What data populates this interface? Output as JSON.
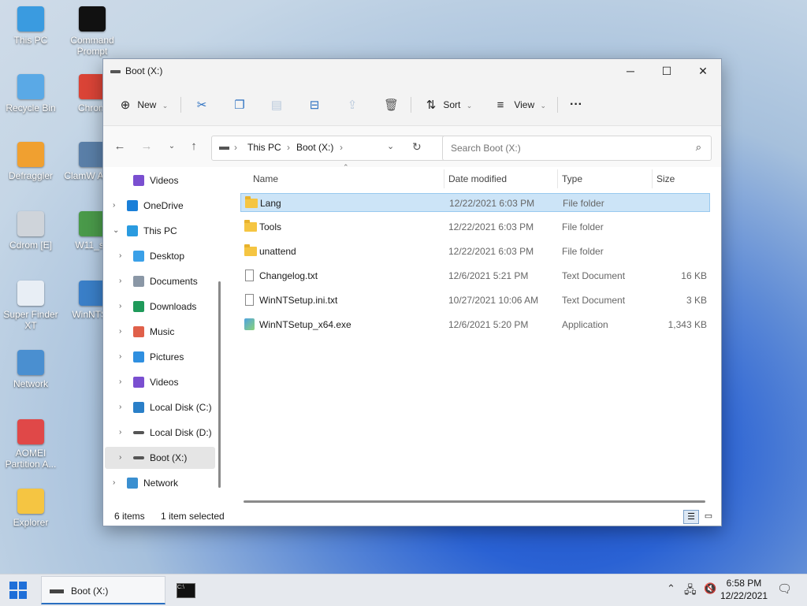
{
  "desktop_icons": [
    {
      "label": "This PC",
      "icon": "monitor-icon",
      "color": "#3a9be0"
    },
    {
      "label": "Command Prompt",
      "icon": "terminal-icon",
      "color": "#111111"
    },
    {
      "label": "Recycle Bin",
      "icon": "recycle-bin-icon",
      "color": "#5aa9e6"
    },
    {
      "label": "Chrom",
      "icon": "chrome-icon",
      "color": "#db4437"
    },
    {
      "label": "Defraggler",
      "icon": "defraggler-icon",
      "color": "#f0a030"
    },
    {
      "label": "ClamW Antivi",
      "icon": "clamwin-icon",
      "color": "#5a7fa8"
    },
    {
      "label": "Cdrom [E]",
      "icon": "cdrom-icon",
      "color": "#cfd4da"
    },
    {
      "label": "W11_se",
      "icon": "setup-icon",
      "color": "#4a9a4a"
    },
    {
      "label": "Super Finder XT",
      "icon": "magnifier-doc-icon",
      "color": "#e8eef5"
    },
    {
      "label": "WinNTSe",
      "icon": "winntsetup-icon",
      "color": "#3a7fc8"
    },
    {
      "label": "Network",
      "icon": "network-icon",
      "color": "#4a8fd0"
    },
    {
      "label": "AOMEI Partition A...",
      "icon": "aomei-icon",
      "color": "#e04848"
    },
    {
      "label": "Explorer",
      "icon": "folder-icon",
      "color": "#f5c542"
    }
  ],
  "window": {
    "title": "Boot (X:)",
    "minimize": "─",
    "maximize": "☐",
    "close": "✕"
  },
  "command_bar": {
    "new_label": "New",
    "sort_label": "Sort",
    "view_label": "View",
    "more": "···"
  },
  "address": {
    "crumbs": [
      "This PC",
      "Boot (X:)"
    ],
    "search_placeholder": "Search Boot (X:)"
  },
  "nav_pane": [
    {
      "label": "Videos",
      "icon": "videos-icon",
      "color": "#7a4fd0",
      "level": 1,
      "chevron": ""
    },
    {
      "label": "OneDrive",
      "icon": "onedrive-icon",
      "color": "#1a7fd8",
      "level": 0,
      "chevron": "›"
    },
    {
      "label": "This PC",
      "icon": "this-pc-icon",
      "color": "#2a9be0",
      "level": 0,
      "chevron": "⌄"
    },
    {
      "label": "Desktop",
      "icon": "desktop-icon",
      "color": "#3aa0e8",
      "level": 1,
      "chevron": "›"
    },
    {
      "label": "Documents",
      "icon": "documents-icon",
      "color": "#8a97a6",
      "level": 1,
      "chevron": "›"
    },
    {
      "label": "Downloads",
      "icon": "downloads-icon",
      "color": "#1f9a5a",
      "level": 1,
      "chevron": "›"
    },
    {
      "label": "Music",
      "icon": "music-icon",
      "color": "#e0604a",
      "level": 1,
      "chevron": "›"
    },
    {
      "label": "Pictures",
      "icon": "pictures-icon",
      "color": "#2f8fe0",
      "level": 1,
      "chevron": "›"
    },
    {
      "label": "Videos",
      "icon": "videos-icon",
      "color": "#7a4fd0",
      "level": 1,
      "chevron": "›"
    },
    {
      "label": "Local Disk (C:)",
      "icon": "windows-drive-icon",
      "color": "#2a7fc8",
      "level": 1,
      "chevron": "›"
    },
    {
      "label": "Local Disk (D:)",
      "icon": "drive-icon",
      "color": "#555555",
      "level": 1,
      "chevron": "›"
    },
    {
      "label": "Boot (X:)",
      "icon": "drive-icon",
      "color": "#555555",
      "level": 1,
      "chevron": "›",
      "selected": true
    },
    {
      "label": "Network",
      "icon": "network-icon",
      "color": "#3a8fd0",
      "level": 0,
      "chevron": "›"
    }
  ],
  "columns": {
    "name": "Name",
    "date": "Date modified",
    "type": "Type",
    "size": "Size"
  },
  "files": [
    {
      "name": "Lang",
      "date": "12/22/2021 6:03 PM",
      "type": "File folder",
      "size": "",
      "kind": "folder",
      "selected": true
    },
    {
      "name": "Tools",
      "date": "12/22/2021 6:03 PM",
      "type": "File folder",
      "size": "",
      "kind": "folder"
    },
    {
      "name": "unattend",
      "date": "12/22/2021 6:03 PM",
      "type": "File folder",
      "size": "",
      "kind": "folder"
    },
    {
      "name": "Changelog.txt",
      "date": "12/6/2021 5:21 PM",
      "type": "Text Document",
      "size": "16 KB",
      "kind": "doc"
    },
    {
      "name": "WinNTSetup.ini.txt",
      "date": "10/27/2021 10:06 AM",
      "type": "Text Document",
      "size": "3 KB",
      "kind": "doc"
    },
    {
      "name": "WinNTSetup_x64.exe",
      "date": "12/6/2021 5:20 PM",
      "type": "Application",
      "size": "1,343 KB",
      "kind": "exe"
    }
  ],
  "status": {
    "items": "6 items",
    "selected": "1 item selected"
  },
  "taskbar": {
    "active_label": "Boot (X:)",
    "time": "6:58 PM",
    "date": "12/22/2021"
  }
}
